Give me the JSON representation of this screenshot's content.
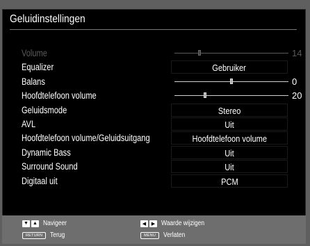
{
  "title": "Geluidinstellingen",
  "rows": [
    {
      "label": "Volume",
      "type": "slider",
      "value": "14",
      "level": 0.22,
      "disabled": true
    },
    {
      "label": "Equalizer",
      "type": "select",
      "value": "Gebruiker"
    },
    {
      "label": "Balans",
      "type": "slider",
      "value": "0",
      "level": 0.5
    },
    {
      "label": "Hoofdtelefoon volume",
      "type": "slider",
      "value": "20",
      "level": 0.27
    },
    {
      "label": "Geluidsmode",
      "type": "select",
      "value": "Stereo"
    },
    {
      "label": "AVL",
      "type": "select",
      "value": "Uit"
    },
    {
      "label": "Hoofdtelefoon volume/Geluidsuitgang",
      "type": "select",
      "value": "Hoofdtelefoon volume"
    },
    {
      "label": "Dynamic Bass",
      "type": "select",
      "value": "Uit"
    },
    {
      "label": "Surround Sound",
      "type": "select",
      "value": "Uit"
    },
    {
      "label": "Digitaal uit",
      "type": "select",
      "value": "PCM"
    }
  ],
  "footer": {
    "navigate": "Navigeer",
    "back_key": "RETURN",
    "back": "Terug",
    "change": "Waarde wijzigen",
    "menu_key": "MENU",
    "exit": "Verlaten"
  }
}
